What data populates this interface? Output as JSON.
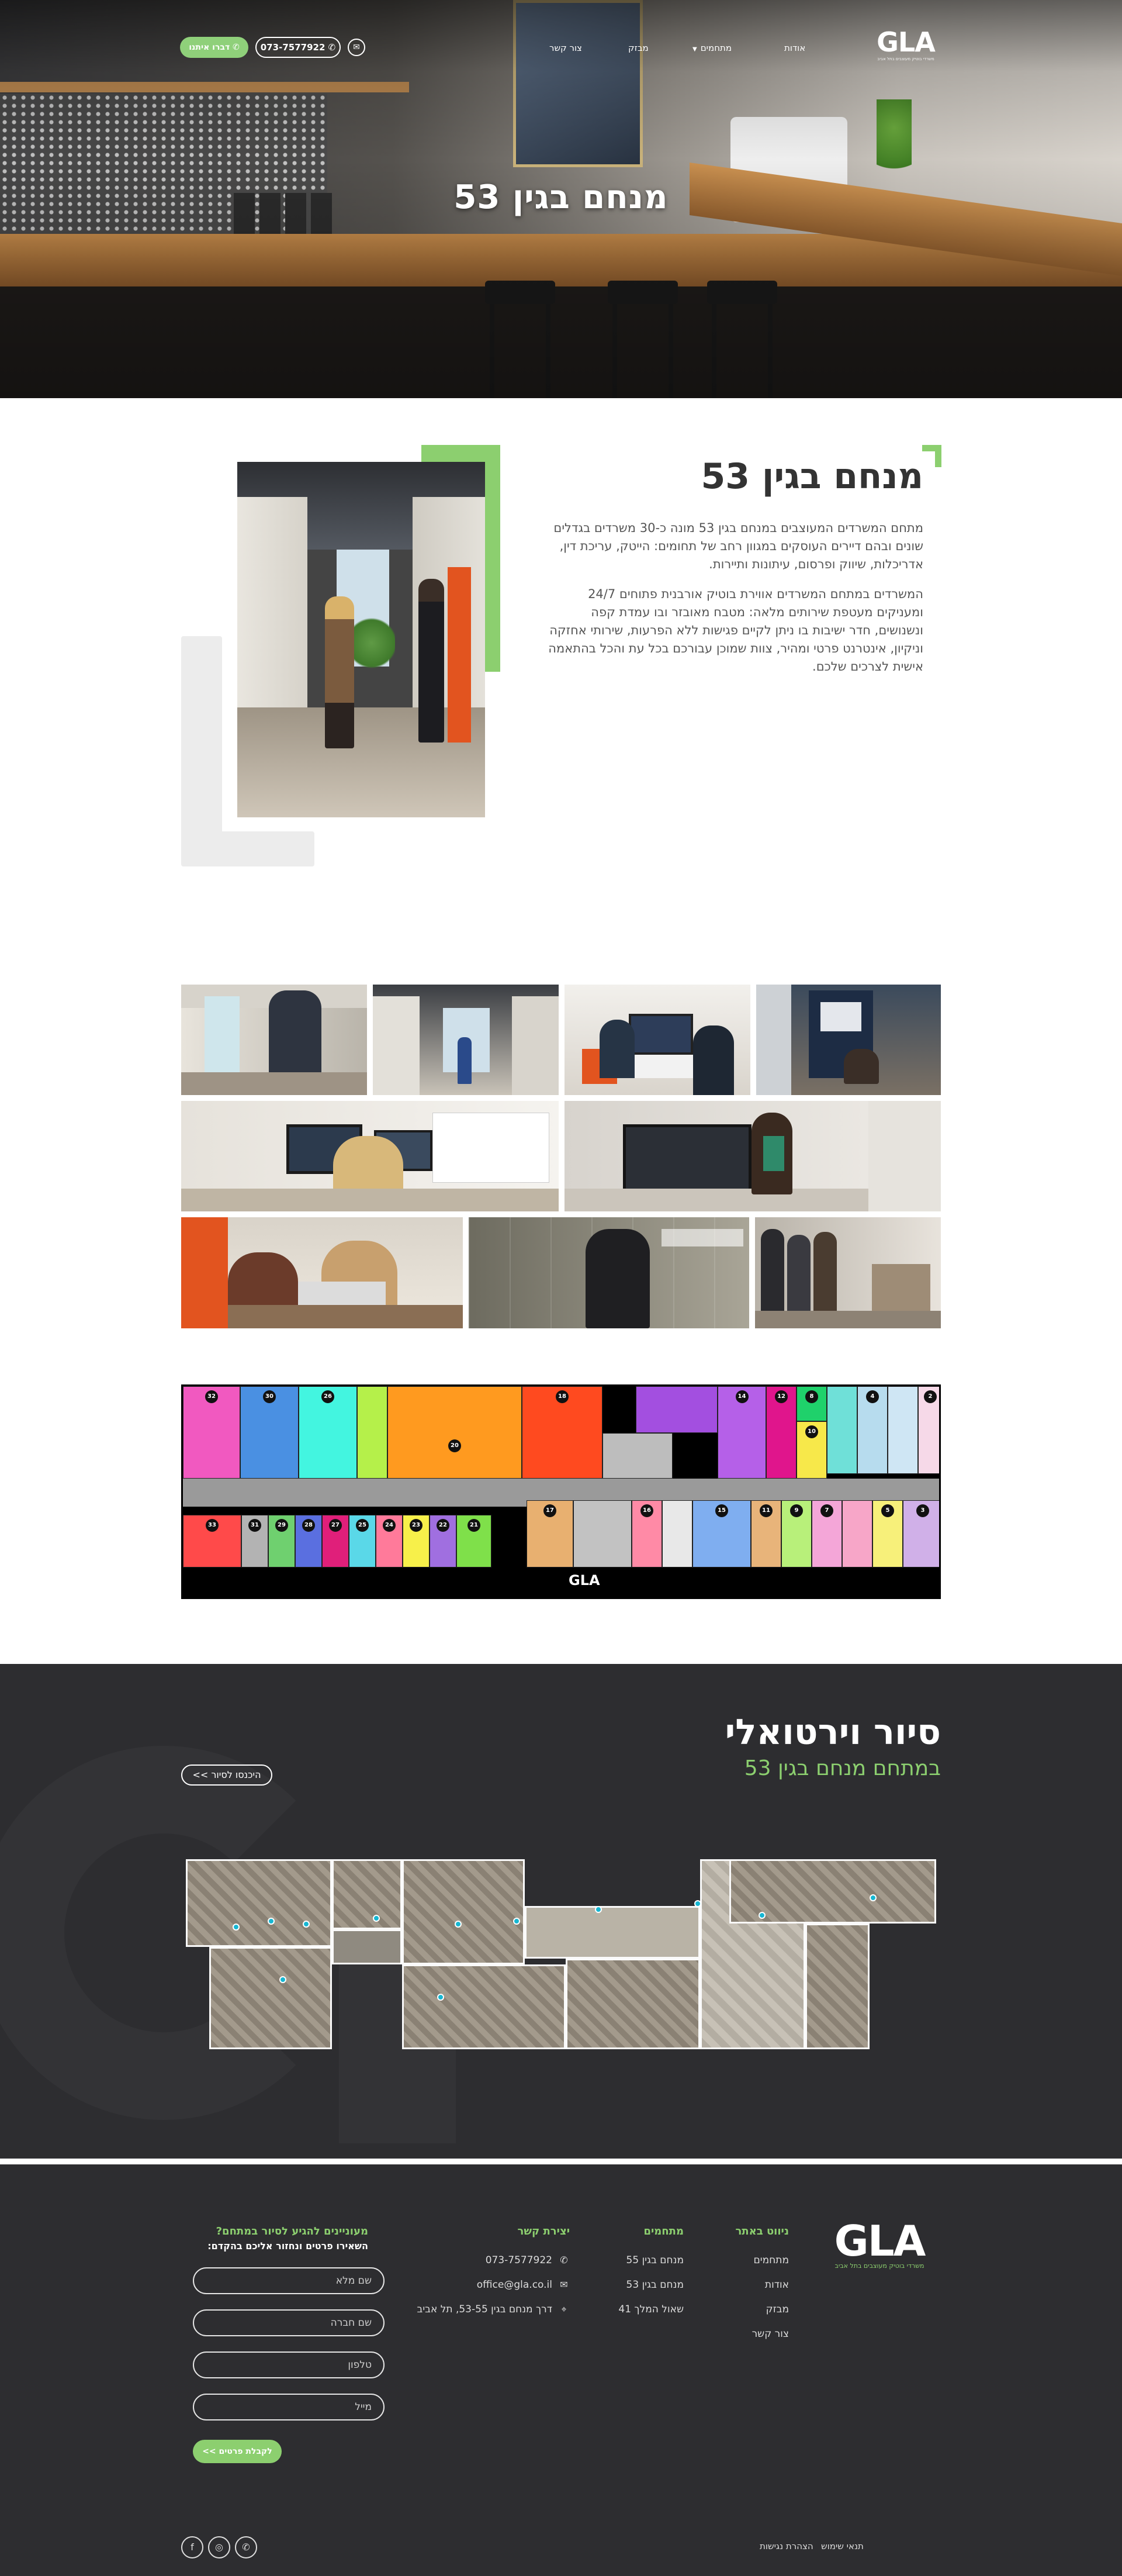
{
  "header": {
    "logo_mark": "GLA",
    "logo_sub": "משרדי בוטיק מעוצבים בתל אביב",
    "nav": [
      {
        "label": "אודות",
        "has_caret": false
      },
      {
        "label": "מתחמים",
        "has_caret": true
      },
      {
        "label": "מבזק",
        "has_caret": false
      },
      {
        "label": "צור קשר",
        "has_caret": false
      }
    ],
    "phone_label": "073-7577922",
    "talk_label": "דברו איתנו"
  },
  "hero": {
    "title": "מנחם בגין 53"
  },
  "intro": {
    "title": "מנחם בגין 53",
    "p1": "מתחם המשרדים המעוצבים במנחם בגין 53 מונה כ-30 משרדים בגדלים שונים ובהם דיירים העוסקים במגוון רחב של תחומים: הייטק, עריכת דין, אדריכלות, שיווק ופרסום, עיתונות ותיירות.",
    "p2": "המשרדים במתחם המשרדים אווירת בוטיק אורבנית פתוחים 24/7 ומעניקים מעטפת שירותים מלאה: מטבח מאובזר ובו עמדת קפה ונשנושים, חדר ישיבות בו ניתן לקיים פגישות ללא הפרעות, שירותי אחזקה וניקיון, אינטרנט פרטי ומהיר, צוות שמוכן עבורכם בכל עת והכל בהתאמה אישית לצרכים שלכם."
  },
  "floorplan": {
    "logo": "GLA",
    "rooms_top": [
      "32",
      "30",
      "26",
      "20",
      "18",
      "14",
      "12",
      "10",
      "8",
      "4",
      "2"
    ],
    "rooms_bottom": [
      "33",
      "31",
      "29",
      "28",
      "27",
      "25",
      "24",
      "23",
      "22",
      "21",
      "17",
      "16",
      "15",
      "11",
      "9",
      "7",
      "5",
      "3",
      "1"
    ]
  },
  "tour": {
    "title": "סיור וירטואלי",
    "subtitle": "במתחם מנחם בגין 53",
    "button_label": "היכנסו לסיור >>"
  },
  "footer": {
    "logo_mark": "GLA",
    "logo_sub": "משרדי בוטיק מעוצבים בתל אביב",
    "nav_col": {
      "title": "ניווט באתר",
      "items": [
        "מתחמים",
        "אודות",
        "מבזק",
        "צור קשר"
      ]
    },
    "complexes_col": {
      "title": "מתחמים",
      "items": [
        "מנחם בגין 55",
        "מנחם בגין 53",
        "שאול המלך 41"
      ]
    },
    "contact_col": {
      "title": "יצירת קשר",
      "phone": "073-7577922",
      "email": "office@gla.co.il",
      "address": "דרך מנחם בגין 53-55, תל אביב"
    },
    "form": {
      "title": "מעוניינים להגיע לסיור במתחם?",
      "subtitle": "השאירו פרטים ונחזור אליכם בהקדם:",
      "name_placeholder": "שם מלא",
      "company_placeholder": "שם חברה",
      "phone_placeholder": "טלפון",
      "email_placeholder": "מייל",
      "submit_label": "לקבלת פרטים >>"
    },
    "terms": "תנאי שימוש",
    "accessibility": "הצהרת נגישות",
    "social_icons": [
      "whatsapp-icon",
      "instagram-icon",
      "facebook-icon"
    ]
  },
  "colors": {
    "accent_green": "#8ccf6f",
    "dark_bg": "#2d2d30"
  }
}
